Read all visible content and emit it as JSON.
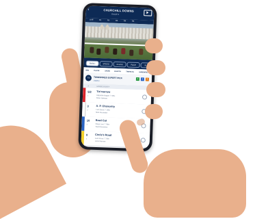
{
  "app": {
    "track_name": "CHURCHILL DOWNS",
    "race_label": "RACE 5",
    "subbar_items": [
      "LIVE",
      "R1",
      "R2",
      "R3",
      "R4",
      "R5"
    ]
  },
  "tabs": [
    "BASIC",
    "SPEED",
    "CLASS",
    "PACE",
    "B"
  ],
  "subnav": [
    "WIN",
    "PLACE",
    "SHOW",
    "EXACTA",
    "TRIFECTA",
    "SUPERFECTA"
  ],
  "expert_pick": {
    "title": "TWINSPIRES EXPERT PICK",
    "subtitle": "VIDEO",
    "badges": [
      {
        "label": "1",
        "color": "#2b9a45"
      },
      {
        "label": "2",
        "color": "#2a64c4"
      },
      {
        "label": "3",
        "color": "#e07b1a"
      }
    ]
  },
  "table_header": [
    "#",
    "HORSE/JOCKEY"
  ],
  "runners": [
    {
      "num": "1",
      "odds": "5/2",
      "name": "Tiz'morrow",
      "age": "(6)",
      "trainer": "Alejandro Magno 7 7/8m",
      "jockey": "Deon Johnson",
      "color": "#d8262e"
    },
    {
      "num": "2",
      "odds": "3",
      "name": "A. P. Chancetry",
      "age": "(7)",
      "trainer": "Luis Saenz 7 1/8m",
      "jockey": "Mike Alexander",
      "color": "#ffffff"
    },
    {
      "num": "3",
      "odds": "10",
      "name": "Bowl Cut",
      "age": "(9)",
      "trainer": "Diego Lara 7 7/8m",
      "jockey": "Tapit Romantics",
      "color": "#2a64c4"
    },
    {
      "num": "4",
      "odds": "8",
      "name": "Circle's Road",
      "age": "(7)",
      "trainer": "Juan Perez 7 7/8m",
      "jockey": "Lionel Hernan",
      "color": "#f3d12a"
    }
  ]
}
